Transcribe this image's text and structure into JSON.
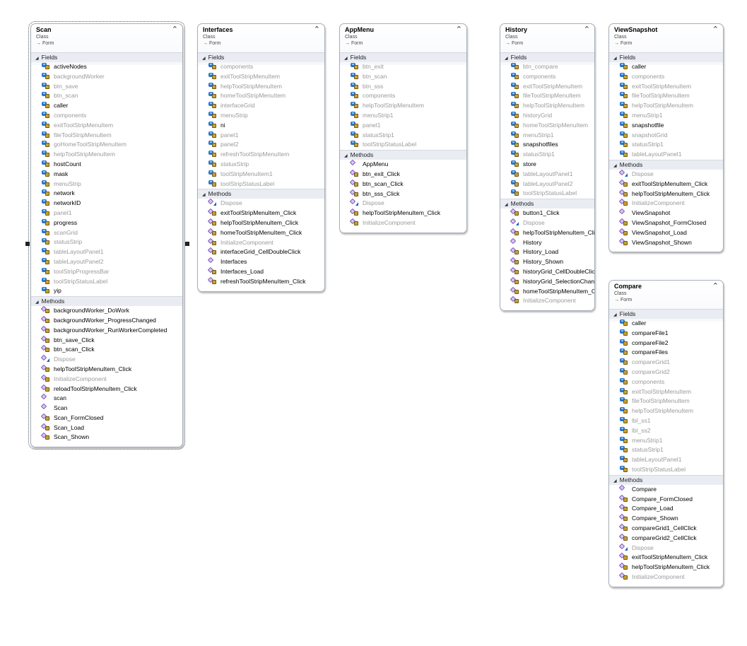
{
  "classes": [
    {
      "id": "scan",
      "name": "Scan",
      "kind": "Class",
      "base": "→ Form",
      "fields_label": "Fields",
      "methods_label": "Methods",
      "fields": [
        {
          "n": "activeNodes",
          "d": false
        },
        {
          "n": "backgroundWorker",
          "d": true
        },
        {
          "n": "btn_save",
          "d": true
        },
        {
          "n": "btn_scan",
          "d": true
        },
        {
          "n": "caller",
          "d": false
        },
        {
          "n": "components",
          "d": true
        },
        {
          "n": "exitToolStripMenuItem",
          "d": true
        },
        {
          "n": "fileToolStripMenuItem",
          "d": true
        },
        {
          "n": "goHomeToolStripMenuItem",
          "d": true
        },
        {
          "n": "helpToolStripMenuItem",
          "d": true
        },
        {
          "n": "hostCount",
          "d": false
        },
        {
          "n": "mask",
          "d": false
        },
        {
          "n": "menuStrip",
          "d": true
        },
        {
          "n": "network",
          "d": false
        },
        {
          "n": "networkID",
          "d": false
        },
        {
          "n": "panel1",
          "d": true
        },
        {
          "n": "progress",
          "d": false
        },
        {
          "n": "scanGrid",
          "d": true
        },
        {
          "n": "statusStrip",
          "d": true
        },
        {
          "n": "tableLayoutPanel1",
          "d": true
        },
        {
          "n": "tableLayoutPanel2",
          "d": true
        },
        {
          "n": "toolStripProgressBar",
          "d": true
        },
        {
          "n": "toolStripStatusLabel",
          "d": true
        },
        {
          "n": "yip",
          "d": false
        }
      ],
      "methods": [
        {
          "n": "backgroundWorker_DoWork",
          "d": false,
          "a": "priv"
        },
        {
          "n": "backgroundWorker_ProgressChanged",
          "d": false,
          "a": "priv"
        },
        {
          "n": "backgroundWorker_RunWorkerCompleted",
          "d": false,
          "a": "priv"
        },
        {
          "n": "btn_save_Click",
          "d": false,
          "a": "priv"
        },
        {
          "n": "btn_scan_Click",
          "d": false,
          "a": "priv"
        },
        {
          "n": "Dispose",
          "d": true,
          "a": "pro"
        },
        {
          "n": "helpToolStripMenuItem_Click",
          "d": false,
          "a": "priv"
        },
        {
          "n": "InitializeComponent",
          "d": true,
          "a": "priv"
        },
        {
          "n": "reloadToolStripMenuItem_Click",
          "d": false,
          "a": "priv"
        },
        {
          "n": "scan",
          "d": false,
          "a": "pub"
        },
        {
          "n": "Scan",
          "d": false,
          "a": "pub"
        },
        {
          "n": "Scan_FormClosed",
          "d": false,
          "a": "priv"
        },
        {
          "n": "Scan_Load",
          "d": false,
          "a": "priv"
        },
        {
          "n": "Scan_Shown",
          "d": false,
          "a": "priv"
        }
      ]
    },
    {
      "id": "interfaces",
      "name": "Interfaces",
      "kind": "Class",
      "base": "→ Form",
      "fields_label": "Fields",
      "methods_label": "Methods",
      "fields": [
        {
          "n": "components",
          "d": true
        },
        {
          "n": "exitToolStripMenuItem",
          "d": true
        },
        {
          "n": "helpToolStripMenuItem",
          "d": true
        },
        {
          "n": "homeToolStripMenuItem",
          "d": true
        },
        {
          "n": "interfaceGrid",
          "d": true
        },
        {
          "n": "menuStrip",
          "d": true
        },
        {
          "n": "ni",
          "d": false
        },
        {
          "n": "panel1",
          "d": true
        },
        {
          "n": "panel2",
          "d": true
        },
        {
          "n": "refreshToolStripMenuItem",
          "d": true
        },
        {
          "n": "statusStrip",
          "d": true
        },
        {
          "n": "toolStripMenuItem1",
          "d": true
        },
        {
          "n": "toolStripStatusLabel",
          "d": true
        }
      ],
      "methods": [
        {
          "n": "Dispose",
          "d": true,
          "a": "pro"
        },
        {
          "n": "exitToolStripMenuItem_Click",
          "d": false,
          "a": "priv"
        },
        {
          "n": "helpToolStripMenuItem_Click",
          "d": false,
          "a": "priv"
        },
        {
          "n": "homeToolStripMenuItem_Click",
          "d": false,
          "a": "priv"
        },
        {
          "n": "InitializeComponent",
          "d": true,
          "a": "priv"
        },
        {
          "n": "interfaceGrid_CellDoubleClick",
          "d": false,
          "a": "priv"
        },
        {
          "n": "Interfaces",
          "d": false,
          "a": "pub"
        },
        {
          "n": "Interfaces_Load",
          "d": false,
          "a": "priv"
        },
        {
          "n": "refreshToolStripMenuItem_Click",
          "d": false,
          "a": "priv"
        }
      ]
    },
    {
      "id": "appmenu",
      "name": "AppMenu",
      "kind": "Class",
      "base": "→ Form",
      "fields_label": "Fields",
      "methods_label": "Methods",
      "fields": [
        {
          "n": "btn_exit",
          "d": true
        },
        {
          "n": "btn_scan",
          "d": true
        },
        {
          "n": "btn_sss",
          "d": true
        },
        {
          "n": "components",
          "d": true
        },
        {
          "n": "helpToolStripMenuItem",
          "d": true
        },
        {
          "n": "menuStrip1",
          "d": true
        },
        {
          "n": "panel1",
          "d": true
        },
        {
          "n": "statusStrip1",
          "d": true
        },
        {
          "n": "toolStripStatusLabel",
          "d": true
        }
      ],
      "methods": [
        {
          "n": "AppMenu",
          "d": false,
          "a": "pub"
        },
        {
          "n": "btn_exit_Click",
          "d": false,
          "a": "priv"
        },
        {
          "n": "btn_scan_Click",
          "d": false,
          "a": "priv"
        },
        {
          "n": "btn_sss_Click",
          "d": false,
          "a": "priv"
        },
        {
          "n": "Dispose",
          "d": true,
          "a": "pro"
        },
        {
          "n": "helpToolStripMenuItem_Click",
          "d": false,
          "a": "priv"
        },
        {
          "n": "InitializeComponent",
          "d": true,
          "a": "priv"
        }
      ]
    },
    {
      "id": "history",
      "name": "History",
      "kind": "Class",
      "base": "→ Form",
      "fields_label": "Fields",
      "methods_label": "Methods",
      "fields": [
        {
          "n": "btn_compare",
          "d": true
        },
        {
          "n": "components",
          "d": true
        },
        {
          "n": "exitToolStripMenuItem",
          "d": true
        },
        {
          "n": "fileToolStripMenuItem",
          "d": true
        },
        {
          "n": "helpToolStripMenuItem",
          "d": true
        },
        {
          "n": "historyGrid",
          "d": true
        },
        {
          "n": "homeToolStripMenuItem",
          "d": true
        },
        {
          "n": "menuStrip1",
          "d": true
        },
        {
          "n": "snapshotfiles",
          "d": false
        },
        {
          "n": "statusStrip1",
          "d": true
        },
        {
          "n": "store",
          "d": false
        },
        {
          "n": "tableLayoutPanel1",
          "d": true
        },
        {
          "n": "tableLayoutPanel2",
          "d": true
        },
        {
          "n": "toolStripStatusLabel",
          "d": true
        }
      ],
      "methods": [
        {
          "n": "button1_Click",
          "d": false,
          "a": "priv"
        },
        {
          "n": "Dispose",
          "d": true,
          "a": "pro"
        },
        {
          "n": "helpToolStripMenuItem_Click",
          "d": false,
          "a": "priv"
        },
        {
          "n": "History",
          "d": false,
          "a": "pub"
        },
        {
          "n": "History_Load",
          "d": false,
          "a": "priv"
        },
        {
          "n": "History_Shown",
          "d": false,
          "a": "priv"
        },
        {
          "n": "historyGrid_CellDoubleClick",
          "d": false,
          "a": "priv"
        },
        {
          "n": "historyGrid_SelectionChanged",
          "d": false,
          "a": "priv"
        },
        {
          "n": "homeToolStripMenuItem_Click",
          "d": false,
          "a": "priv"
        },
        {
          "n": "InitializeComponent",
          "d": true,
          "a": "priv"
        }
      ]
    },
    {
      "id": "viewsnapshot",
      "name": "ViewSnapshot",
      "kind": "Class",
      "base": "→ Form",
      "fields_label": "Fields",
      "methods_label": "Methods",
      "fields": [
        {
          "n": "caller",
          "d": false
        },
        {
          "n": "components",
          "d": true
        },
        {
          "n": "exitToolStripMenuItem",
          "d": true
        },
        {
          "n": "fileToolStripMenuItem",
          "d": true
        },
        {
          "n": "helpToolStripMenuItem",
          "d": true
        },
        {
          "n": "menuStrip1",
          "d": true
        },
        {
          "n": "snapshotfile",
          "d": false
        },
        {
          "n": "snapshotGrid",
          "d": true
        },
        {
          "n": "statusStrip1",
          "d": true
        },
        {
          "n": "tableLayoutPanel1",
          "d": true
        }
      ],
      "methods": [
        {
          "n": "Dispose",
          "d": true,
          "a": "pro"
        },
        {
          "n": "exitToolStripMenuItem_Click",
          "d": false,
          "a": "priv"
        },
        {
          "n": "helpToolStripMenuItem_Click",
          "d": false,
          "a": "priv"
        },
        {
          "n": "InitializeComponent",
          "d": true,
          "a": "priv"
        },
        {
          "n": "ViewSnapshot",
          "d": false,
          "a": "pub"
        },
        {
          "n": "ViewSnapshot_FormClosed",
          "d": false,
          "a": "priv"
        },
        {
          "n": "ViewSnapshot_Load",
          "d": false,
          "a": "priv"
        },
        {
          "n": "ViewSnapshot_Shown",
          "d": false,
          "a": "priv"
        }
      ]
    },
    {
      "id": "compare",
      "name": "Compare",
      "kind": "Class",
      "base": "→ Form",
      "fields_label": "Fields",
      "methods_label": "Methods",
      "fields": [
        {
          "n": "caller",
          "d": false
        },
        {
          "n": "compareFile1",
          "d": false
        },
        {
          "n": "compareFile2",
          "d": false
        },
        {
          "n": "compareFiles",
          "d": false
        },
        {
          "n": "compareGrid1",
          "d": true
        },
        {
          "n": "compareGrid2",
          "d": true
        },
        {
          "n": "components",
          "d": true
        },
        {
          "n": "exitToolStripMenuItem",
          "d": true
        },
        {
          "n": "fileToolStripMenuItem",
          "d": true
        },
        {
          "n": "helpToolStripMenuItem",
          "d": true
        },
        {
          "n": "lbl_ss1",
          "d": true
        },
        {
          "n": "lbl_ss2",
          "d": true
        },
        {
          "n": "menuStrip1",
          "d": true
        },
        {
          "n": "statusStrip1",
          "d": true
        },
        {
          "n": "tableLayoutPanel1",
          "d": true
        },
        {
          "n": "toolStripStatusLabel",
          "d": true
        }
      ],
      "methods": [
        {
          "n": "Compare",
          "d": false,
          "a": "pub"
        },
        {
          "n": "Compare_FormClosed",
          "d": false,
          "a": "priv"
        },
        {
          "n": "Compare_Load",
          "d": false,
          "a": "priv"
        },
        {
          "n": "Compare_Shown",
          "d": false,
          "a": "priv"
        },
        {
          "n": "compareGrid1_CellClick",
          "d": false,
          "a": "priv"
        },
        {
          "n": "compareGrid2_CellClick",
          "d": false,
          "a": "priv"
        },
        {
          "n": "Dispose",
          "d": true,
          "a": "pro"
        },
        {
          "n": "exitToolStripMenuItem_Click",
          "d": false,
          "a": "priv"
        },
        {
          "n": "helpToolStripMenuItem_Click",
          "d": false,
          "a": "priv"
        },
        {
          "n": "InitializeComponent",
          "d": true,
          "a": "priv"
        }
      ]
    }
  ]
}
